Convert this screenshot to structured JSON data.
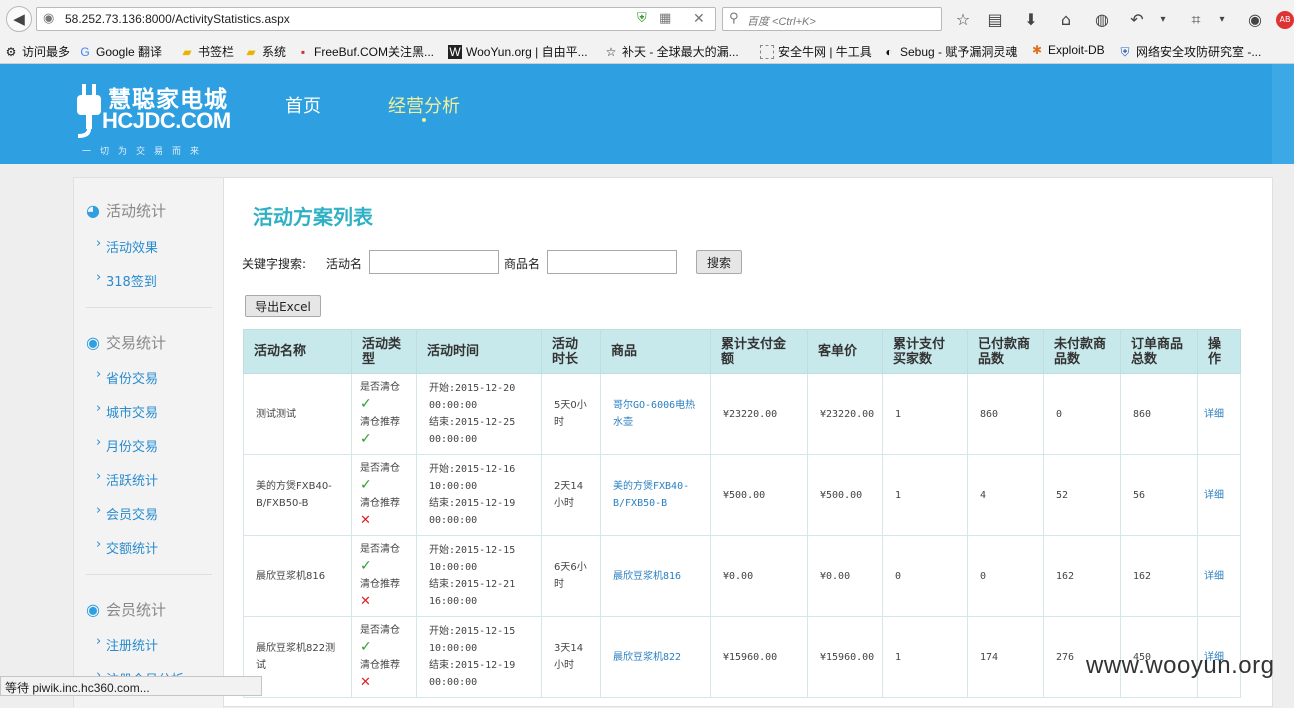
{
  "browser": {
    "url": "58.252.73.136:8000/ActivityStatistics.aspx",
    "search_placeholder": "百度 <Ctrl+K>",
    "bookmarks": [
      {
        "label": "访问最多"
      },
      {
        "label": "Google 翻译"
      },
      {
        "label": "书签栏"
      },
      {
        "label": "系统"
      },
      {
        "label": "FreeBuf.COM关注黑..."
      },
      {
        "label": "WooYun.org | 自由平..."
      },
      {
        "label": "补天 - 全球最大的漏..."
      },
      {
        "label": "安全牛网 | 牛工具"
      },
      {
        "label": "Sebug - 赋予漏洞灵魂"
      },
      {
        "label": "Exploit-DB"
      },
      {
        "label": "网络安全攻防研究室 -..."
      }
    ],
    "status": "等待 piwik.inc.hc360.com..."
  },
  "header": {
    "logo_cn": "慧聪家电城",
    "logo_en": "HCJDC.COM",
    "slogan": "一切为交易而来",
    "nav": [
      {
        "label": "首页"
      },
      {
        "label": "经营分析"
      }
    ]
  },
  "sidebar": {
    "groups": [
      {
        "title": "活动统计",
        "items": [
          "活动效果",
          "318签到"
        ]
      },
      {
        "title": "交易统计",
        "items": [
          "省份交易",
          "城市交易",
          "月份交易",
          "活跃统计",
          "会员交易",
          "交额统计"
        ]
      },
      {
        "title": "会员统计",
        "items": [
          "注册统计",
          "注册会员分析"
        ]
      }
    ]
  },
  "main": {
    "title": "活动方案列表",
    "search": {
      "label": "关键字搜索:",
      "activity_label": "活动名",
      "activity_value": "",
      "product_label": "商品名",
      "product_value": "",
      "button": "搜索"
    },
    "export_button": "导出Excel",
    "columns": [
      "活动名称",
      "活动类型",
      "活动时间",
      "活动时长",
      "商品",
      "累计支付金额",
      "客单价",
      "累计支付买家数",
      "已付款商品数",
      "未付款商品数",
      "订单商品总数",
      "操作"
    ],
    "type_labels": {
      "clear": "是否清仓",
      "recommend": "清仓推荐"
    },
    "rows": [
      {
        "name": "测试测试",
        "clear": true,
        "recommend": true,
        "start": "开始:2015-12-20 00:00:00",
        "end": "结束:2015-12-25 00:00:00",
        "duration": "5天0小时",
        "product": "哥尔GO-6006电热水壶",
        "amount": "¥23220.00",
        "unit_price": "¥23220.00",
        "buyers": "1",
        "paid": "860",
        "unpaid": "0",
        "total": "860",
        "op": "详细"
      },
      {
        "name": "美的方煲FXB40-B/FXB50-B",
        "clear": true,
        "recommend": false,
        "start": "开始:2015-12-16 10:00:00",
        "end": "结束:2015-12-19 00:00:00",
        "duration": "2天14小时",
        "product": "美的方煲FXB40-B/FXB50-B",
        "amount": "¥500.00",
        "unit_price": "¥500.00",
        "buyers": "1",
        "paid": "4",
        "unpaid": "52",
        "total": "56",
        "op": "详细"
      },
      {
        "name": "晨欣豆浆机816",
        "clear": true,
        "recommend": false,
        "start": "开始:2015-12-15 10:00:00",
        "end": "结束:2015-12-21 16:00:00",
        "duration": "6天6小时",
        "product": "晨欣豆浆机816",
        "amount": "¥0.00",
        "unit_price": "¥0.00",
        "buyers": "0",
        "paid": "0",
        "unpaid": "162",
        "total": "162",
        "op": "详细"
      },
      {
        "name": "晨欣豆浆机822测试",
        "clear": true,
        "recommend": false,
        "start": "开始:2015-12-15 10:00:00",
        "end": "结束:2015-12-19 00:00:00",
        "duration": "3天14小时",
        "product": "晨欣豆浆机822",
        "amount": "¥15960.00",
        "unit_price": "¥15960.00",
        "buyers": "1",
        "paid": "174",
        "unpaid": "276",
        "total": "450",
        "op": "详细"
      }
    ]
  },
  "watermark": "www.wooyun.org",
  "colors": {
    "header_bg": "#2e9fe0",
    "title": "#2fb0c4",
    "table_head": "#c8e9ec",
    "link": "#2a7fc0"
  }
}
